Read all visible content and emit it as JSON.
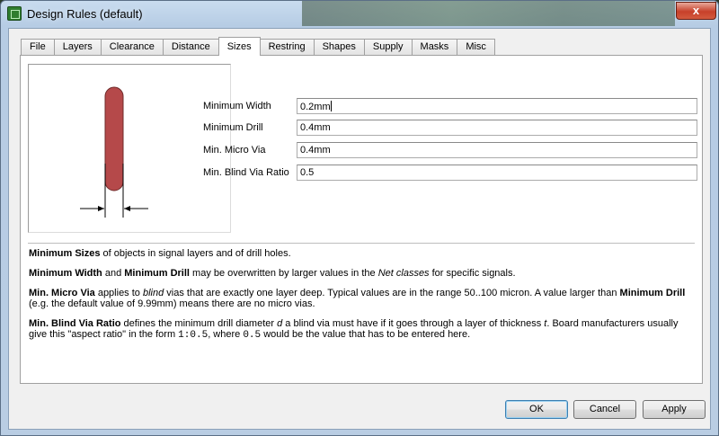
{
  "window": {
    "title": "Design Rules (default)",
    "close_label": "x"
  },
  "tabs": [
    {
      "label": "File"
    },
    {
      "label": "Layers"
    },
    {
      "label": "Clearance"
    },
    {
      "label": "Distance"
    },
    {
      "label": "Sizes",
      "active": true
    },
    {
      "label": "Restring"
    },
    {
      "label": "Shapes"
    },
    {
      "label": "Supply"
    },
    {
      "label": "Masks"
    },
    {
      "label": "Misc"
    }
  ],
  "form": {
    "min_width": {
      "label": "Minimum Width",
      "value": "0.2mm"
    },
    "min_drill": {
      "label": "Minimum Drill",
      "value": "0.4mm"
    },
    "min_micro_via": {
      "label": "Min. Micro Via",
      "value": "0.4mm"
    },
    "min_blind_via_ratio": {
      "label": "Min. Blind Via Ratio",
      "value": "0.5"
    }
  },
  "help": {
    "p1": {
      "b1": "Minimum Sizes",
      "t1": " of objects in signal layers and of drill holes."
    },
    "p2": {
      "b1": "Minimum Width",
      "t1": " and ",
      "b2": "Minimum Drill",
      "t2": " may be overwritten by larger values in the ",
      "i1": "Net classes",
      "t3": " for specific signals."
    },
    "p3": {
      "b1": "Min. Micro Via",
      "t1": " applies to ",
      "i1": "blind",
      "t2": " vias that are exactly one layer deep. Typical values are in the range 50..100 micron. A value larger than ",
      "b2": "Minimum Drill",
      "t3": " (e.g. the default value of 9.99mm) means there are no micro vias."
    },
    "p4": {
      "b1": "Min. Blind Via Ratio",
      "t1": " defines the minimum drill diameter ",
      "i1": "d",
      "t2": " a blind via must have if it goes through a layer of thickness ",
      "i2": "t",
      "t3": ". Board manufacturers usually give this \"aspect ratio\" in the form ",
      "m1": "1:0.5",
      "t4": ", where ",
      "m2": "0.5",
      "t5": " would be the value that has to be entered here."
    }
  },
  "buttons": {
    "ok": "OK",
    "cancel": "Cancel",
    "apply": "Apply"
  },
  "colors": {
    "trace": "#b5494a",
    "accent": "#3c7fb1"
  }
}
